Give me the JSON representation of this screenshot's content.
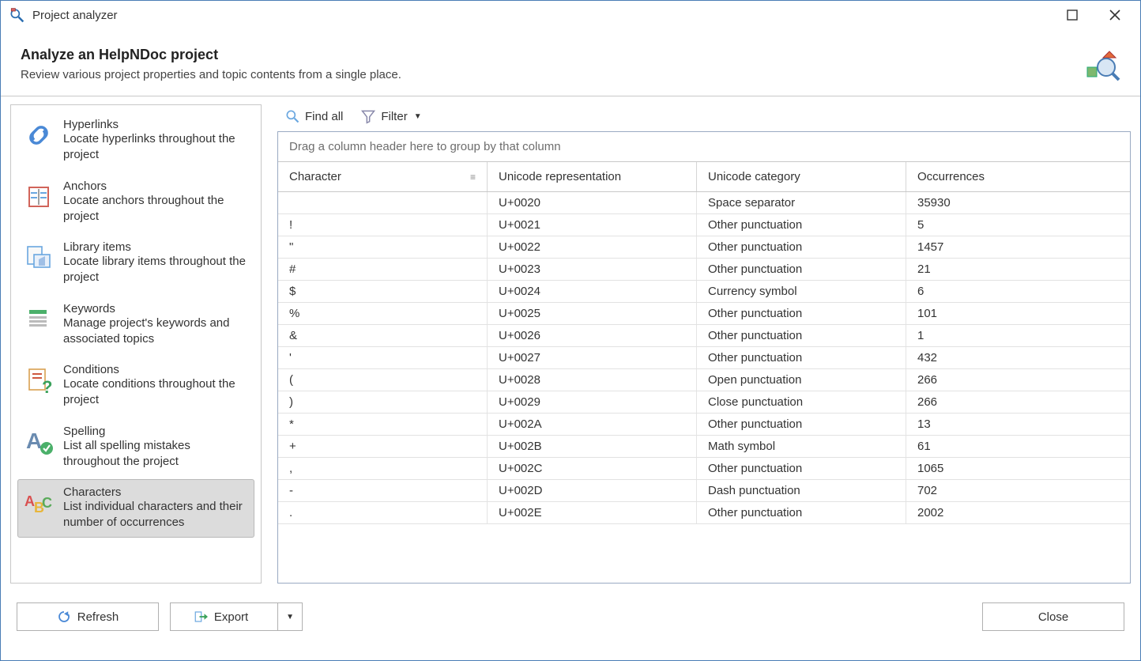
{
  "titlebar": {
    "title": "Project analyzer"
  },
  "header": {
    "title": "Analyze an HelpNDoc project",
    "subtitle": "Review various project properties and topic contents from a single place."
  },
  "sidebar": {
    "items": [
      {
        "title": "Hyperlinks",
        "desc": "Locate hyperlinks throughout the project"
      },
      {
        "title": "Anchors",
        "desc": "Locate anchors throughout the project"
      },
      {
        "title": "Library items",
        "desc": "Locate library items throughout the project"
      },
      {
        "title": "Keywords",
        "desc": "Manage project's keywords and associated topics"
      },
      {
        "title": "Conditions",
        "desc": "Locate conditions throughout the project"
      },
      {
        "title": "Spelling",
        "desc": "List all spelling mistakes throughout the project"
      },
      {
        "title": "Characters",
        "desc": "List individual characters and their number of occurrences"
      }
    ]
  },
  "toolbar": {
    "findall": "Find all",
    "filter": "Filter"
  },
  "grid": {
    "group_hint": "Drag a column header here to group by that column",
    "columns": [
      "Character",
      "Unicode representation",
      "Unicode category",
      "Occurrences"
    ],
    "rows": [
      {
        "char": " ",
        "uni": "U+0020",
        "cat": "Space separator",
        "occ": "35930"
      },
      {
        "char": "!",
        "uni": "U+0021",
        "cat": "Other punctuation",
        "occ": "5"
      },
      {
        "char": "\"",
        "uni": "U+0022",
        "cat": "Other punctuation",
        "occ": "1457"
      },
      {
        "char": "#",
        "uni": "U+0023",
        "cat": "Other punctuation",
        "occ": "21"
      },
      {
        "char": "$",
        "uni": "U+0024",
        "cat": "Currency symbol",
        "occ": "6"
      },
      {
        "char": "%",
        "uni": "U+0025",
        "cat": "Other punctuation",
        "occ": "101"
      },
      {
        "char": "&",
        "uni": "U+0026",
        "cat": "Other punctuation",
        "occ": "1"
      },
      {
        "char": "'",
        "uni": "U+0027",
        "cat": "Other punctuation",
        "occ": "432"
      },
      {
        "char": "(",
        "uni": "U+0028",
        "cat": "Open punctuation",
        "occ": "266"
      },
      {
        "char": ")",
        "uni": "U+0029",
        "cat": "Close punctuation",
        "occ": "266"
      },
      {
        "char": "*",
        "uni": "U+002A",
        "cat": "Other punctuation",
        "occ": "13"
      },
      {
        "char": "+",
        "uni": "U+002B",
        "cat": "Math symbol",
        "occ": "61"
      },
      {
        "char": ",",
        "uni": "U+002C",
        "cat": "Other punctuation",
        "occ": "1065"
      },
      {
        "char": "-",
        "uni": "U+002D",
        "cat": "Dash punctuation",
        "occ": "702"
      },
      {
        "char": ".",
        "uni": "U+002E",
        "cat": "Other punctuation",
        "occ": "2002"
      }
    ]
  },
  "footer": {
    "refresh": "Refresh",
    "export": "Export",
    "close": "Close"
  }
}
